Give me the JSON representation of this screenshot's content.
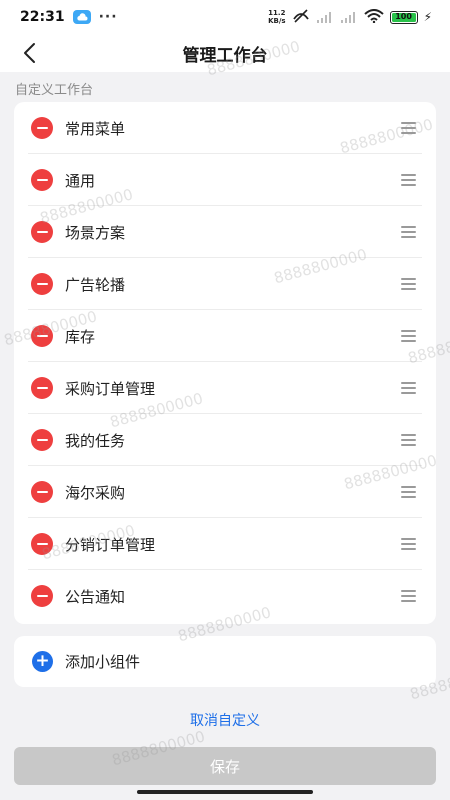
{
  "status_bar": {
    "time": "22:31",
    "more": "···",
    "net_speed_value": "11.2",
    "net_speed_unit": "KB/s",
    "battery": "100"
  },
  "header": {
    "title": "管理工作台"
  },
  "section_label": "自定义工作台",
  "widgets": [
    {
      "label": "常用菜单"
    },
    {
      "label": "通用"
    },
    {
      "label": "场景方案"
    },
    {
      "label": "广告轮播"
    },
    {
      "label": "库存"
    },
    {
      "label": "采购订单管理"
    },
    {
      "label": "我的任务"
    },
    {
      "label": "海尔采购"
    },
    {
      "label": "分销订单管理"
    },
    {
      "label": "公告通知"
    }
  ],
  "add_widget": {
    "label": "添加小组件"
  },
  "cancel_label": "取消自定义",
  "save_label": "保存",
  "watermark_text": "8888800000",
  "colors": {
    "remove": "#ee3f3f",
    "accent": "#1e6fe8",
    "save_disabled": "#c8c8c8"
  }
}
